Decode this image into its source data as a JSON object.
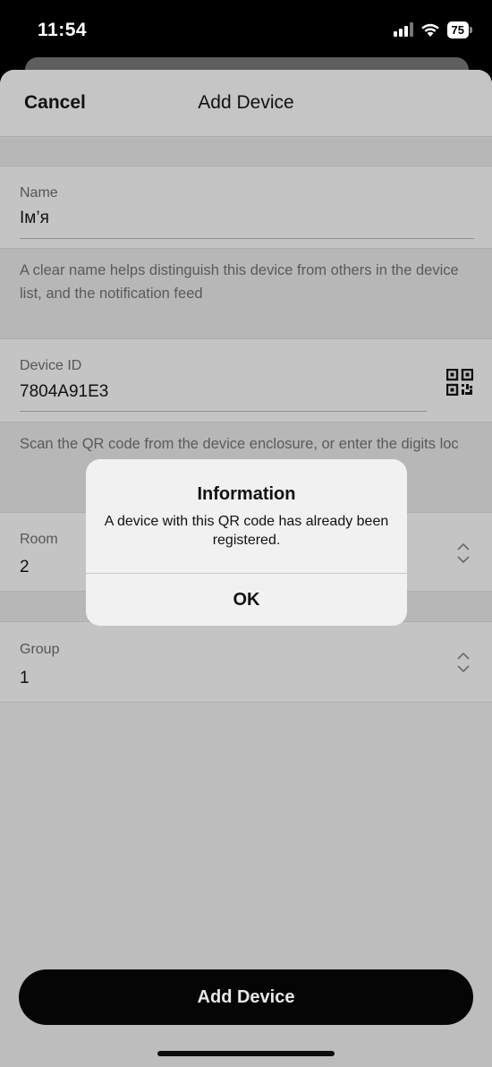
{
  "status_bar": {
    "time": "11:54",
    "battery": "75",
    "icons": [
      "signal-icon",
      "wifi-icon",
      "battery-icon"
    ]
  },
  "nav": {
    "cancel_label": "Cancel",
    "title": "Add Device"
  },
  "form": {
    "name": {
      "label": "Name",
      "value": "Ім’я",
      "hint": "A clear name helps distinguish this device from others in the device list, and the notification feed"
    },
    "device_id": {
      "label": "Device ID",
      "value": "7804A91E3",
      "hint": "Scan the QR code from the device enclosure, or enter the digits loc",
      "icon": "qr-code-icon"
    },
    "room": {
      "label": "Room",
      "value": "2",
      "icon": "chevron-up-down-icon"
    },
    "group": {
      "label": "Group",
      "value": "1",
      "icon": "chevron-up-down-icon"
    }
  },
  "add_button_label": "Add Device",
  "alert": {
    "title": "Information",
    "message": "A device with this QR code has already been registered.",
    "ok_label": "OK"
  },
  "colors": {
    "background": "#bdbdbd",
    "card": "#c4c4c4",
    "button": "#050505",
    "alert": "#f1f1f1"
  }
}
